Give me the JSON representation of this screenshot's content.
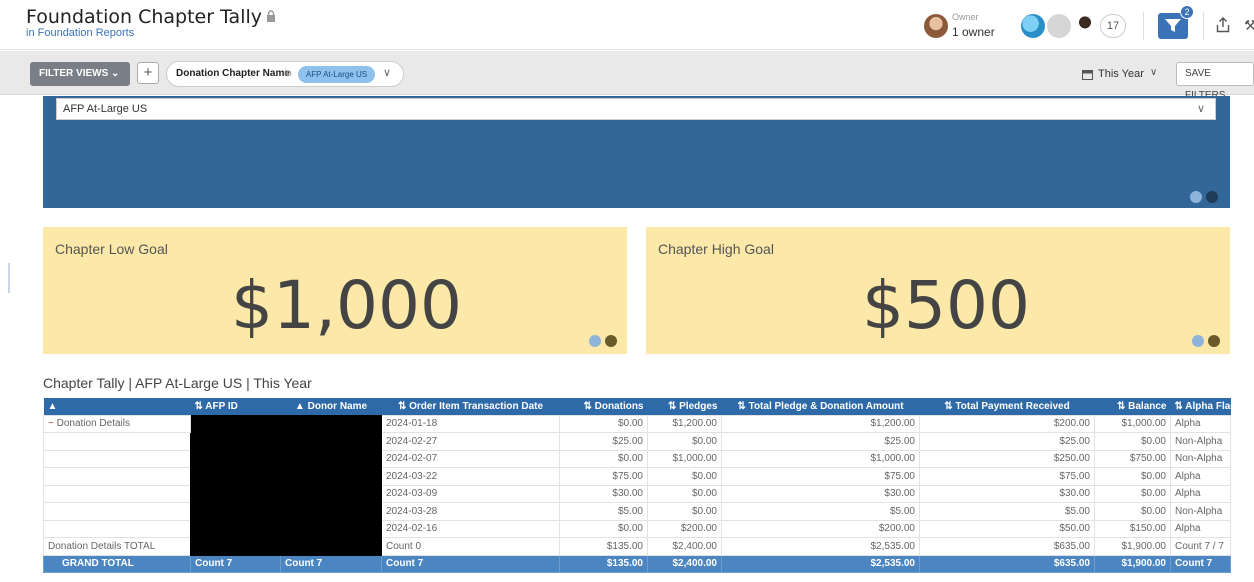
{
  "header": {
    "title": "Foundation Chapter Tally",
    "subtitle": "in Foundation Reports",
    "owner_label": "Owner",
    "owner_value": "1 owner",
    "viewer_count": "17",
    "filter_badge": "2"
  },
  "filterbar": {
    "filter_views_label": "FILTER VIEWS",
    "add_label": "+",
    "chip_field": "Donation Chapter Name",
    "chip_in": "in",
    "chip_value": "AFP At-Large US",
    "date_label": "This Year",
    "save_label": "SAVE FILTERS"
  },
  "panel": {
    "selected": "AFP At-Large US"
  },
  "goals": {
    "low_label": "Chapter Low Goal",
    "low_value": "$1,000",
    "high_label": "Chapter High Goal",
    "high_value": "$500"
  },
  "table": {
    "title": "Chapter Tally | AFP At-Large US | This Year",
    "headers": [
      "",
      "AFP ID",
      "Donor Name",
      "Order Item Transaction Date",
      "Donations",
      "Pledges",
      "Total Pledge & Donation Amount",
      "Total Payment Received",
      "Balance",
      "Alpha Flag"
    ],
    "group_label": "Donation Details",
    "rows": [
      {
        "date": "2024-01-18",
        "donations": "$0.00",
        "pledges": "$1,200.00",
        "total": "$1,200.00",
        "received": "$200.00",
        "balance": "$1,000.00",
        "flag": "Alpha"
      },
      {
        "date": "2024-02-27",
        "donations": "$25.00",
        "pledges": "$0.00",
        "total": "$25.00",
        "received": "$25.00",
        "balance": "$0.00",
        "flag": "Non-Alpha"
      },
      {
        "date": "2024-02-07",
        "donations": "$0.00",
        "pledges": "$1,000.00",
        "total": "$1,000.00",
        "received": "$250.00",
        "balance": "$750.00",
        "flag": "Non-Alpha"
      },
      {
        "date": "2024-03-22",
        "donations": "$75.00",
        "pledges": "$0.00",
        "total": "$75.00",
        "received": "$75.00",
        "balance": "$0.00",
        "flag": "Alpha"
      },
      {
        "date": "2024-03-09",
        "donations": "$30.00",
        "pledges": "$0.00",
        "total": "$30.00",
        "received": "$30.00",
        "balance": "$0.00",
        "flag": "Alpha"
      },
      {
        "date": "2024-03-28",
        "donations": "$5.00",
        "pledges": "$0.00",
        "total": "$5.00",
        "received": "$5.00",
        "balance": "$0.00",
        "flag": "Non-Alpha"
      },
      {
        "date": "2024-02-16",
        "donations": "$0.00",
        "pledges": "$200.00",
        "total": "$200.00",
        "received": "$50.00",
        "balance": "$150.00",
        "flag": "Alpha"
      }
    ],
    "subtotal": {
      "label": "Donation Details TOTAL",
      "date": "Count 0",
      "donations": "$135.00",
      "pledges": "$2,400.00",
      "total": "$2,535.00",
      "received": "$635.00",
      "balance": "$1,900.00",
      "flag": "Count 7 / 7"
    },
    "grand": {
      "label": "GRAND TOTAL",
      "afp": "Count 7",
      "donor": "Count 7",
      "date": "Count 7",
      "donations": "$135.00",
      "pledges": "$2,400.00",
      "total": "$2,535.00",
      "received": "$635.00",
      "balance": "$1,900.00",
      "flag": "Count 7"
    }
  },
  "colors": {
    "brand": "#3b73b9",
    "panel": "#336699",
    "goal_bg": "#fce8a8",
    "table_header": "#2e6aa7",
    "grand_total": "#4b86c2"
  }
}
